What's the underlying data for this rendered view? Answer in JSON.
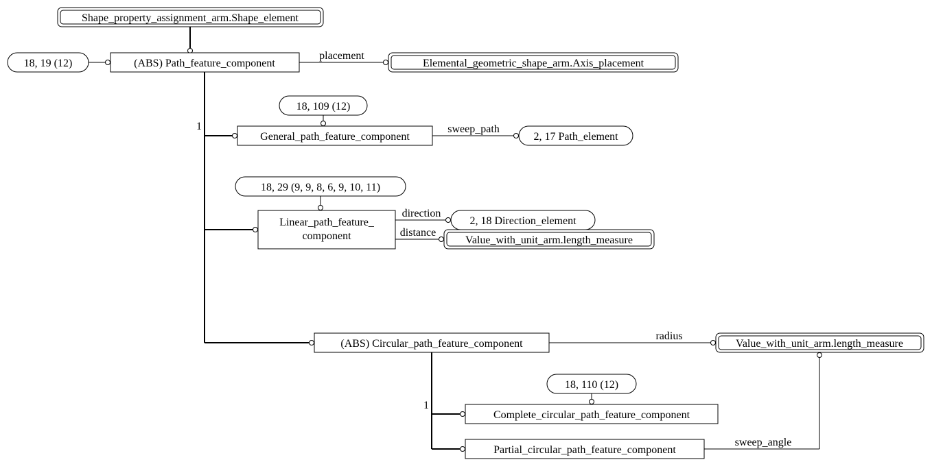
{
  "nodes": {
    "shape_element": "Shape_property_assignment_arm.Shape_element",
    "path_feature_component": "(ABS) Path_feature_component",
    "ref_pfc": "18, 19 (12)",
    "axis_placement": "Elemental_geometric_shape_arm.Axis_placement",
    "general_pfc": "General_path_feature_component",
    "ref_general": "18, 109 (12)",
    "path_element": "2, 17 Path_element",
    "linear_pfc_line1": "Linear_path_feature_",
    "linear_pfc_line2": "component",
    "ref_linear": "18, 29 (9, 9, 8, 6, 9, 10, 11)",
    "direction_element": "2, 18 Direction_element",
    "length_measure1": "Value_with_unit_arm.length_measure",
    "circular_pfc": "(ABS) Circular_path_feature_component",
    "length_measure2": "Value_with_unit_arm.length_measure",
    "complete_circ": "Complete_circular_path_feature_component",
    "ref_complete": "18, 110 (12)",
    "partial_circ": "Partial_circular_path_feature_component"
  },
  "edges": {
    "placement": "placement",
    "sweep_path": "sweep_path",
    "direction": "direction",
    "distance": "distance",
    "radius": "radius",
    "sweep_angle": "sweep_angle",
    "one_a": "1",
    "one_b": "1"
  }
}
